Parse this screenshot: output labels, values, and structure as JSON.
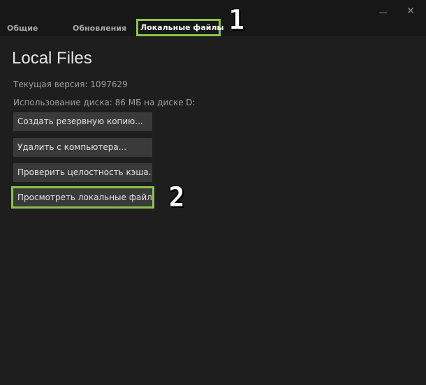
{
  "tabs": {
    "general": "Общие",
    "updates": "Обновления",
    "local_files": "Локальные файлы"
  },
  "window": {
    "minimize_icon": "minimize-icon",
    "close_icon": "close-icon",
    "close_glyph": "✕"
  },
  "annotations": {
    "first": "1",
    "second": "2",
    "highlight_color": "#8bc34a"
  },
  "content": {
    "heading": "Local Files",
    "version": "Текущая версия: 1097629",
    "disk_usage": "Использование диска: 86 МБ на диске D:"
  },
  "buttons": {
    "backup": "Создать резервную копию...",
    "uninstall": "Удалить с компьютера...",
    "verify": "Проверить целостность кэша...",
    "browse": "Просмотреть локальные файлы..."
  }
}
